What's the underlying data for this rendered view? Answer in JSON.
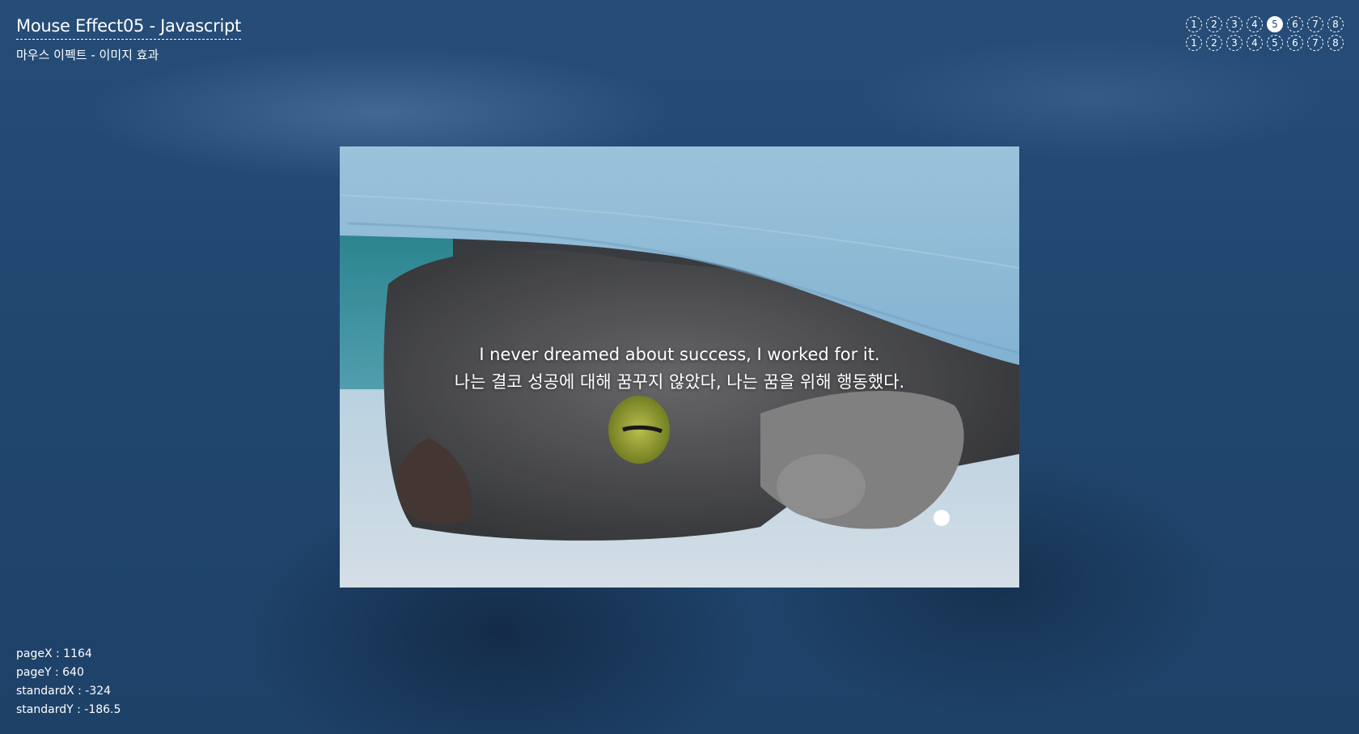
{
  "header": {
    "title": "Mouse Effect05 - Javascript",
    "subtitle": "마우스 이펙트 - 이미지 효과"
  },
  "pagination": {
    "row1": [
      "1",
      "2",
      "3",
      "4",
      "5",
      "6",
      "7",
      "8"
    ],
    "row2": [
      "1",
      "2",
      "3",
      "4",
      "5",
      "6",
      "7",
      "8"
    ],
    "active_row1": "5"
  },
  "card": {
    "image": "cat-under-blue-blanket",
    "quote_en": "I never dreamed about success, I worked for it.",
    "quote_ko": "나는 결코 성공에 대해 꿈꾸지 않았다, 나는 꿈을 위해 행동했다."
  },
  "info": {
    "pageX": "pageX : 1164",
    "pageY": "pageY : 640",
    "standardX": "standardX : -324",
    "standardY": "standardY : -186.5"
  },
  "colors": {
    "background": "#1f4670",
    "text": "#ffffff",
    "blanket": "#9fcbe8"
  }
}
